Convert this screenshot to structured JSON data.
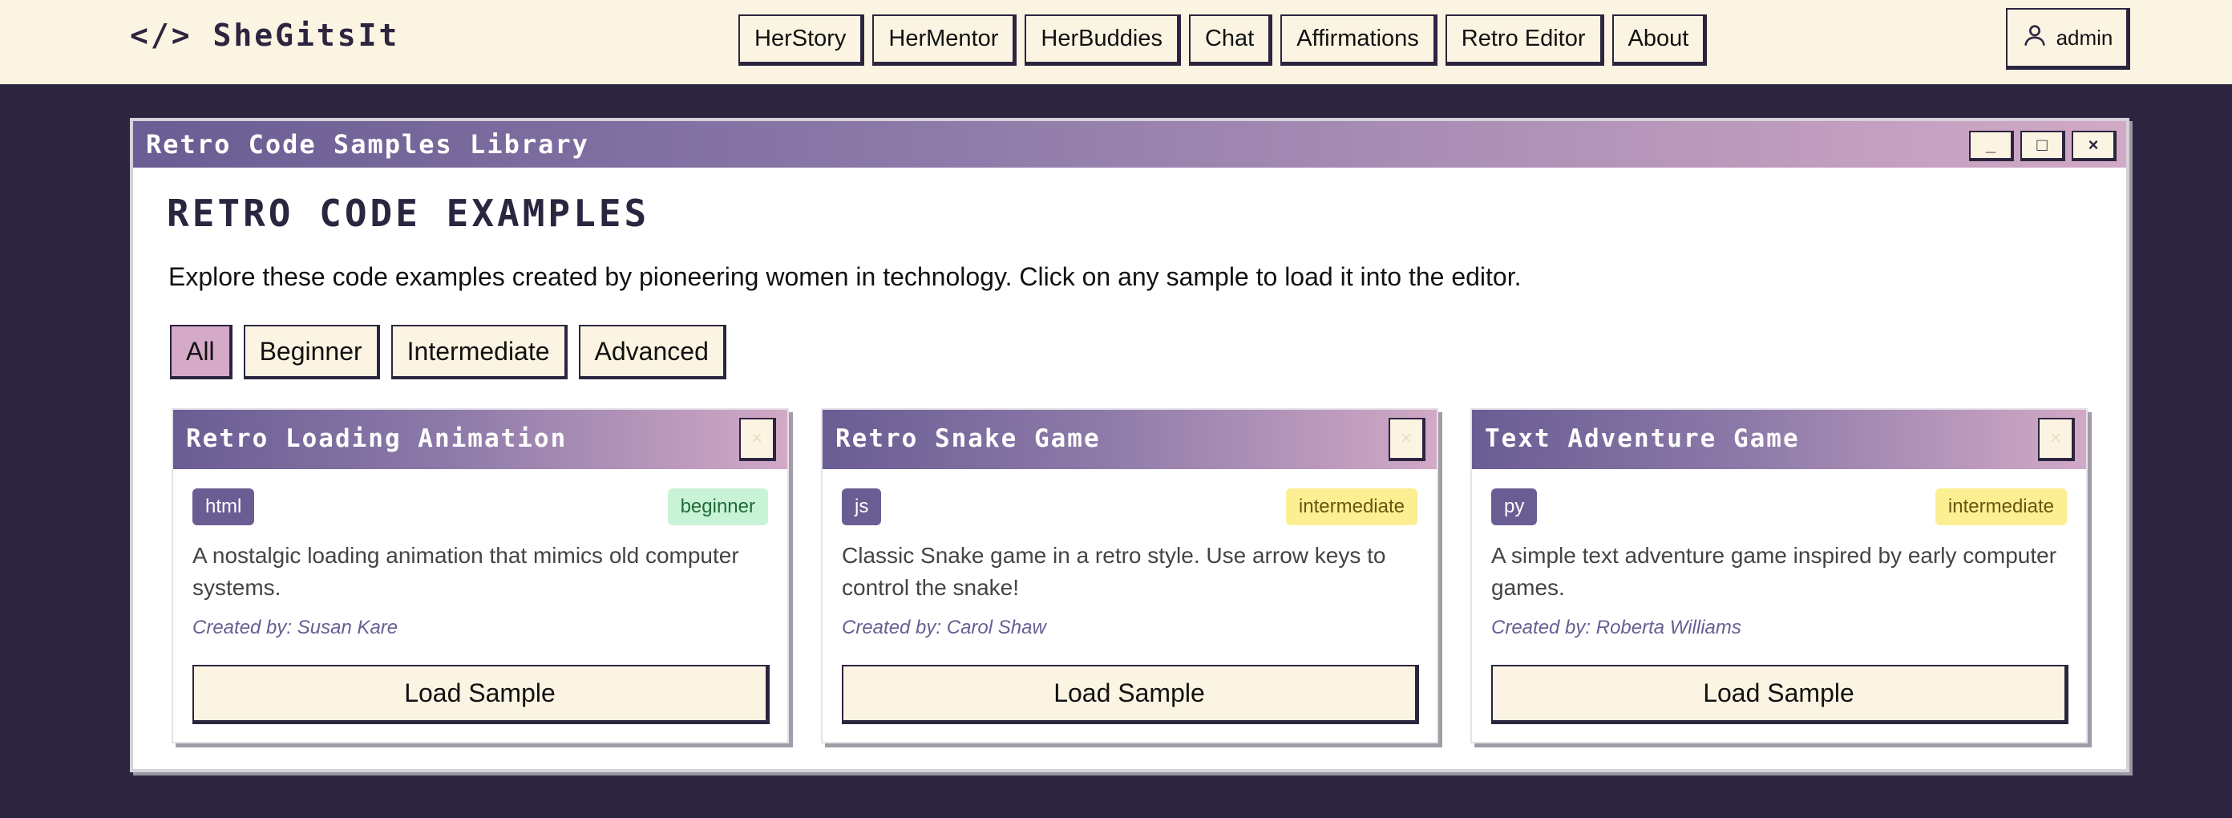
{
  "navbar": {
    "logo": "</> SheGitsIt",
    "links": [
      "HerStory",
      "HerMentor",
      "HerBuddies",
      "Chat",
      "Affirmations",
      "Retro Editor",
      "About"
    ],
    "user_label": "admin",
    "user_icon": "user-icon"
  },
  "window": {
    "title": "Retro Code Samples Library",
    "controls": {
      "minimize": "_",
      "maximize": "□",
      "close": "×"
    }
  },
  "main": {
    "heading": "RETRO CODE EXAMPLES",
    "description": "Explore these code examples created by pioneering women in technology. Click on any sample to load it into the editor.",
    "filters": [
      "All",
      "Beginner",
      "Intermediate",
      "Advanced"
    ],
    "active_filter": "All"
  },
  "cards": [
    {
      "title": "Retro Loading Animation",
      "close": "×",
      "language": "html",
      "level": "beginner",
      "description": "A nostalgic loading animation that mimics old computer systems.",
      "author": "Created by: Susan Kare",
      "button": "Load Sample"
    },
    {
      "title": "Retro Snake Game",
      "close": "×",
      "language": "js",
      "level": "intermediate",
      "description": "Classic Snake game in a retro style. Use arrow keys to control the snake!",
      "author": "Created by: Carol Shaw",
      "button": "Load Sample"
    },
    {
      "title": "Text Adventure Game",
      "close": "×",
      "language": "py",
      "level": "intermediate",
      "description": "A simple text adventure game inspired by early computer games.",
      "author": "Created by: Roberta Williams",
      "button": "Load Sample"
    }
  ],
  "colors": {
    "background": "#2b2540",
    "cream": "#fcf4e2",
    "accent_purple": "#6a5d93",
    "accent_pink": "#d4aac8",
    "beginner_badge": "#c9f3d6",
    "intermediate_badge": "#fbef92"
  }
}
